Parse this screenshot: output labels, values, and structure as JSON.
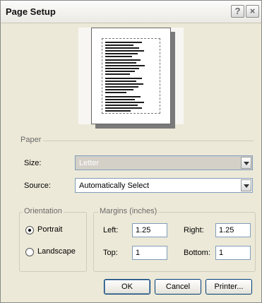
{
  "dialog": {
    "title": "Page Setup",
    "help_label": "?",
    "close_label": "×"
  },
  "paper": {
    "group_label": "Paper",
    "size_label": "Size:",
    "size_value": "Letter",
    "source_label": "Source:",
    "source_value": "Automatically Select"
  },
  "orientation": {
    "group_label": "Orientation",
    "portrait_label": "Portrait",
    "portrait_selected": true,
    "landscape_label": "Landscape",
    "landscape_selected": false
  },
  "margins": {
    "group_label": "Margins (inches)",
    "left_label": "Left:",
    "left_value": "1.25",
    "right_label": "Right:",
    "right_value": "1.25",
    "top_label": "Top:",
    "top_value": "1",
    "bottom_label": "Bottom:",
    "bottom_value": "1"
  },
  "buttons": {
    "ok": "OK",
    "cancel": "Cancel",
    "printer": "Printer..."
  },
  "icons": {
    "help": "help-icon",
    "close": "close-icon",
    "dropdown": "chevron-down-icon"
  }
}
